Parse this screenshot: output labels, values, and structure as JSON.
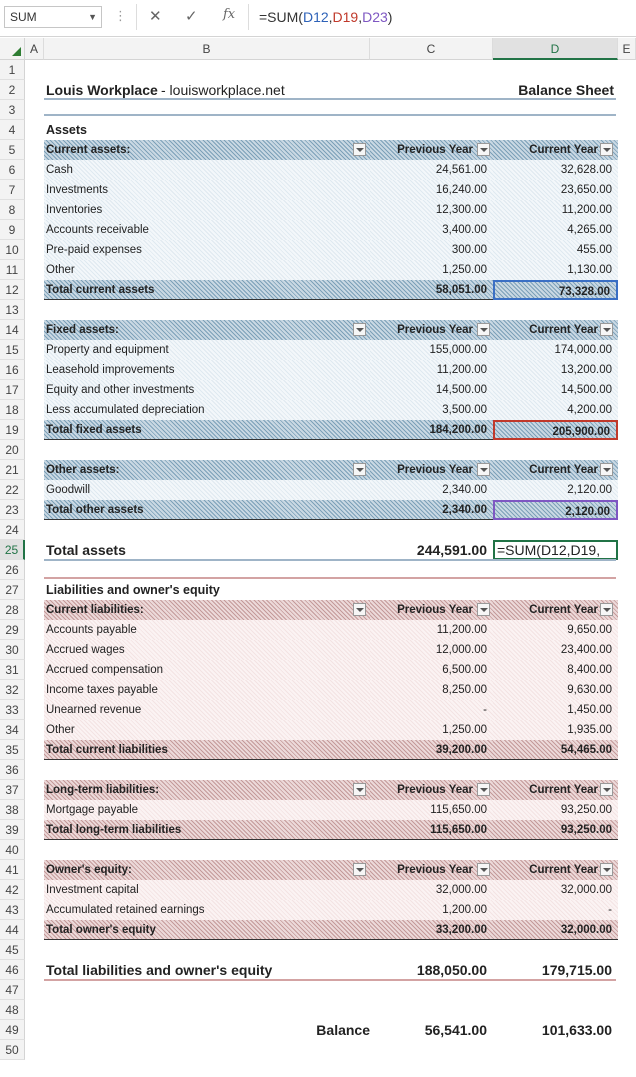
{
  "formula_bar": {
    "name_box": "SUM",
    "cancel_icon": "✕",
    "enter_icon": "✓",
    "fx_label": "fx",
    "formula": {
      "prefix": "=SUM(",
      "r1": "D12",
      "sep1": ",",
      "r2": "D19",
      "sep2": ",",
      "r3": "D23",
      "suffix": ")"
    }
  },
  "columns": [
    "A",
    "B",
    "C",
    "D",
    "E"
  ],
  "rows": [
    "1",
    "2",
    "3",
    "4",
    "5",
    "6",
    "7",
    "8",
    "9",
    "10",
    "11",
    "12",
    "13",
    "14",
    "15",
    "16",
    "17",
    "18",
    "19",
    "20",
    "21",
    "22",
    "23",
    "24",
    "25",
    "26",
    "27",
    "28",
    "29",
    "30",
    "31",
    "32",
    "33",
    "34",
    "35",
    "36",
    "37",
    "38",
    "39",
    "40",
    "41",
    "42",
    "43",
    "44",
    "45",
    "46",
    "47",
    "48",
    "49",
    "50"
  ],
  "header": {
    "company": "Louis Workplace",
    "site": " - louisworkplace.net",
    "sheet_title": "Balance Sheet"
  },
  "col_prev": "Previous Year",
  "col_curr": "Current Year",
  "assets": {
    "title": "Assets",
    "current": {
      "label": "Current assets:",
      "items": [
        {
          "name": "Cash",
          "prev": "24,561.00",
          "curr": "32,628.00"
        },
        {
          "name": "Investments",
          "prev": "16,240.00",
          "curr": "23,650.00"
        },
        {
          "name": "Inventories",
          "prev": "12,300.00",
          "curr": "11,200.00"
        },
        {
          "name": "Accounts receivable",
          "prev": "3,400.00",
          "curr": "4,265.00"
        },
        {
          "name": "Pre-paid expenses",
          "prev": "300.00",
          "curr": "455.00"
        },
        {
          "name": "Other",
          "prev": "1,250.00",
          "curr": "1,130.00"
        }
      ],
      "total": {
        "name": "Total current assets",
        "prev": "58,051.00",
        "curr": "73,328.00"
      }
    },
    "fixed": {
      "label": "Fixed assets:",
      "items": [
        {
          "name": "Property and equipment",
          "prev": "155,000.00",
          "curr": "174,000.00"
        },
        {
          "name": "Leasehold improvements",
          "prev": "11,200.00",
          "curr": "13,200.00"
        },
        {
          "name": "Equity and other investments",
          "prev": "14,500.00",
          "curr": "14,500.00"
        },
        {
          "name": "Less accumulated depreciation",
          "prev": "3,500.00",
          "curr": "4,200.00"
        }
      ],
      "total": {
        "name": "Total fixed assets",
        "prev": "184,200.00",
        "curr": "205,900.00"
      }
    },
    "other": {
      "label": "Other assets:",
      "items": [
        {
          "name": "Goodwill",
          "prev": "2,340.00",
          "curr": "2,120.00"
        }
      ],
      "total": {
        "name": "Total other assets",
        "prev": "2,340.00",
        "curr": "2,120.00"
      }
    },
    "grand": {
      "name": "Total assets",
      "prev": "244,591.00",
      "curr": "=SUM(D12,D19,"
    }
  },
  "liabilities": {
    "title": "Liabilities and owner's equity",
    "current": {
      "label": "Current liabilities:",
      "items": [
        {
          "name": "Accounts payable",
          "prev": "11,200.00",
          "curr": "9,650.00"
        },
        {
          "name": "Accrued wages",
          "prev": "12,000.00",
          "curr": "23,400.00"
        },
        {
          "name": "Accrued compensation",
          "prev": "6,500.00",
          "curr": "8,400.00"
        },
        {
          "name": "Income taxes payable",
          "prev": "8,250.00",
          "curr": "9,630.00"
        },
        {
          "name": "Unearned revenue",
          "prev": "-",
          "curr": "1,450.00"
        },
        {
          "name": "Other",
          "prev": "1,250.00",
          "curr": "1,935.00"
        }
      ],
      "total": {
        "name": "Total current liabilities",
        "prev": "39,200.00",
        "curr": "54,465.00"
      }
    },
    "longterm": {
      "label": "Long-term liabilities:",
      "items": [
        {
          "name": "Mortgage payable",
          "prev": "115,650.00",
          "curr": "93,250.00"
        }
      ],
      "total": {
        "name": "Total long-term liabilities",
        "prev": "115,650.00",
        "curr": "93,250.00"
      }
    },
    "equity": {
      "label": "Owner's equity:",
      "items": [
        {
          "name": "Investment capital",
          "prev": "32,000.00",
          "curr": "32,000.00"
        },
        {
          "name": "Accumulated retained earnings",
          "prev": "1,200.00",
          "curr": "-"
        }
      ],
      "total": {
        "name": "Total owner's equity",
        "prev": "33,200.00",
        "curr": "32,000.00"
      }
    },
    "grand": {
      "name": "Total liabilities and owner's equity",
      "prev": "188,050.00",
      "curr": "179,715.00"
    }
  },
  "balance": {
    "label": "Balance",
    "prev": "56,541.00",
    "curr": "101,633.00"
  }
}
